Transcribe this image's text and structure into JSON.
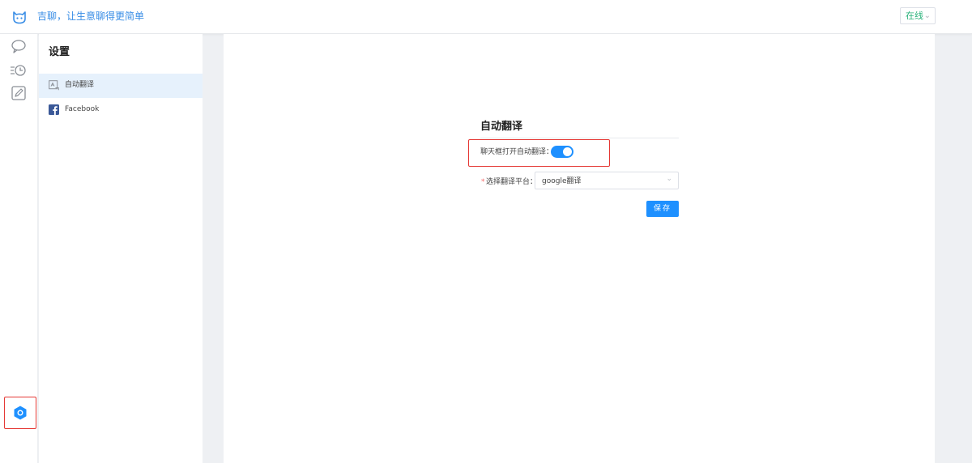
{
  "header": {
    "logo_icon": "cat-face-icon",
    "slogan": "吉聊，让生意聊得更简单",
    "status": {
      "value": "在线",
      "icon": "chevron-down-icon"
    }
  },
  "icon_rail": {
    "items": [
      {
        "icon": "chat-bubble-icon"
      },
      {
        "icon": "history-icon"
      },
      {
        "icon": "edit-icon"
      }
    ],
    "settings_icon": "settings-hexagon-icon",
    "highlight_color": "#e53935"
  },
  "settings_menu": {
    "title": "设置",
    "items": [
      {
        "label": "自动翻译",
        "icon": "translate-icon",
        "active": true
      },
      {
        "label": "Facebook",
        "icon": "facebook-icon",
        "active": false
      }
    ]
  },
  "auto_translate": {
    "title": "自动翻译",
    "toggle": {
      "label": "聊天框打开自动翻译：",
      "on": true
    },
    "platform": {
      "required_mark": "*",
      "label": "选择翻译平台：",
      "value": "google翻译"
    },
    "save_label": "保存"
  },
  "colors": {
    "accent": "#1e90ff",
    "brand_text": "#3a8ee6",
    "status_online": "#2ab27b",
    "active_menu_bg": "#e6f1fc"
  }
}
